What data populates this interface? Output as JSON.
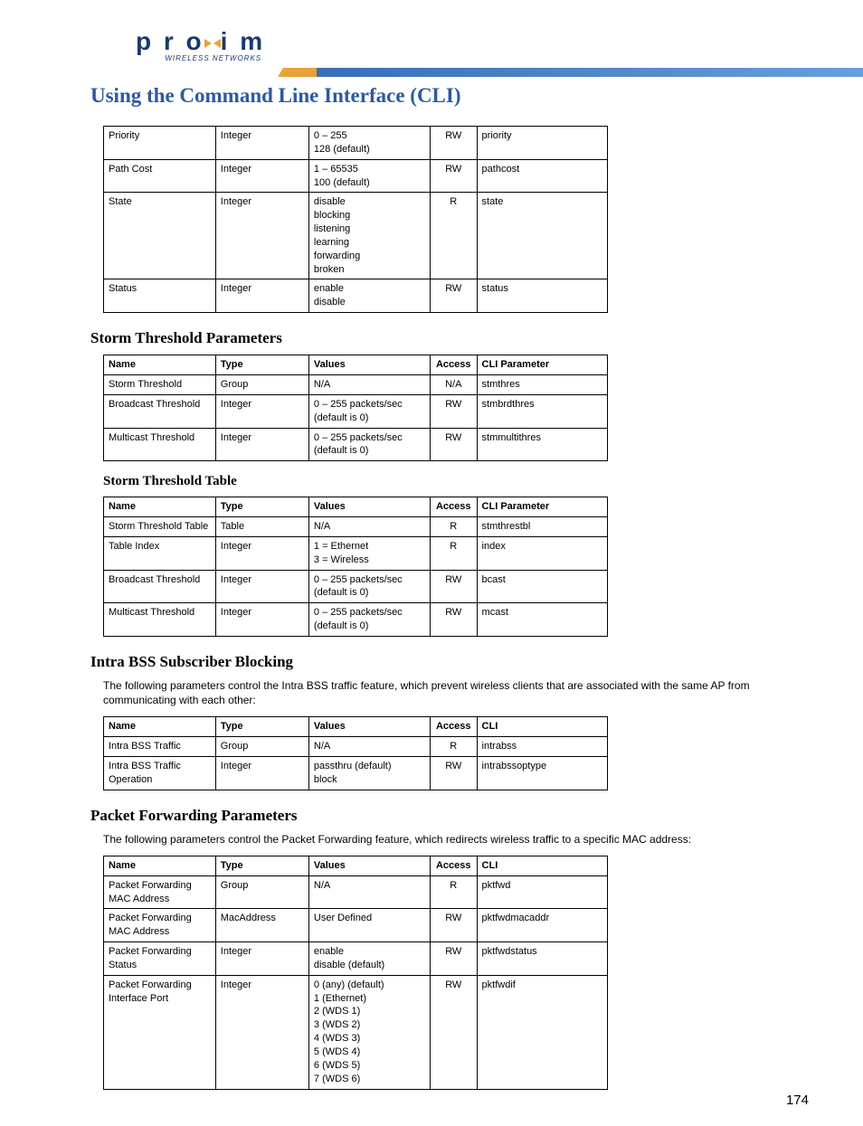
{
  "brand": {
    "name": "proxim",
    "tagline": "WIRELESS NETWORKS"
  },
  "page_title": "Using the Command Line Interface (CLI)",
  "page_number": "174",
  "tables": {
    "top": {
      "rows": [
        {
          "name": "Priority",
          "type": "Integer",
          "values": "0 – 255\n128 (default)",
          "access": "RW",
          "cli": "priority"
        },
        {
          "name": "Path Cost",
          "type": "Integer",
          "values": "1 – 65535\n100 (default)",
          "access": "RW",
          "cli": "pathcost"
        },
        {
          "name": "State",
          "type": "Integer",
          "values": "disable\nblocking\nlistening\nlearning\nforwarding\nbroken",
          "access": "R",
          "cli": "state"
        },
        {
          "name": "Status",
          "type": "Integer",
          "values": "enable\ndisable",
          "access": "RW",
          "cli": "status"
        }
      ]
    },
    "storm_params": {
      "heading": "Storm Threshold Parameters",
      "headers": {
        "name": "Name",
        "type": "Type",
        "values": "Values",
        "access": "Access",
        "cli": "CLI Parameter"
      },
      "rows": [
        {
          "name": "Storm Threshold",
          "type": "Group",
          "values": "N/A",
          "access": "N/A",
          "cli": "stmthres"
        },
        {
          "name": "Broadcast Threshold",
          "type": "Integer",
          "values": "0 – 255 packets/sec\n(default is 0)",
          "access": "RW",
          "cli": "stmbrdthres"
        },
        {
          "name": "Multicast Threshold",
          "type": "Integer",
          "values": "0 – 255 packets/sec\n(default is 0)",
          "access": "RW",
          "cli": "stmmultithres"
        }
      ]
    },
    "storm_table": {
      "heading": "Storm Threshold Table",
      "headers": {
        "name": "Name",
        "type": "Type",
        "values": "Values",
        "access": "Access",
        "cli": "CLI Parameter"
      },
      "rows": [
        {
          "name": "Storm Threshold Table",
          "type": "Table",
          "values": "N/A",
          "access": "R",
          "cli": "stmthrestbl"
        },
        {
          "name": "Table Index",
          "type": "Integer",
          "values": "1 = Ethernet\n3 = Wireless",
          "access": "R",
          "cli": "index"
        },
        {
          "name": "Broadcast Threshold",
          "type": "Integer",
          "values": "0 – 255 packets/sec\n(default is 0)",
          "access": "RW",
          "cli": "bcast"
        },
        {
          "name": "Multicast Threshold",
          "type": "Integer",
          "values": "0 – 255 packets/sec\n(default is 0)",
          "access": "RW",
          "cli": "mcast"
        }
      ]
    },
    "intra_bss": {
      "heading": "Intra BSS Subscriber Blocking",
      "intro": "The following parameters control the Intra BSS traffic feature, which prevent wireless clients that are associated with the same AP from communicating with each other:",
      "headers": {
        "name": "Name",
        "type": "Type",
        "values": "Values",
        "access": "Access",
        "cli": "CLI"
      },
      "rows": [
        {
          "name": "Intra BSS Traffic",
          "type": "Group",
          "values": "N/A",
          "access": "R",
          "cli": "intrabss"
        },
        {
          "name": "Intra BSS Traffic Operation",
          "type": "Integer",
          "values": "passthru (default)\nblock",
          "access": "RW",
          "cli": "intrabssoptype"
        }
      ]
    },
    "packet_fwd": {
      "heading": "Packet Forwarding Parameters",
      "intro": "The following parameters control the Packet Forwarding feature, which redirects wireless traffic to a specific MAC address:",
      "headers": {
        "name": "Name",
        "type": "Type",
        "values": "Values",
        "access": "Access",
        "cli": "CLI"
      },
      "rows": [
        {
          "name": "Packet Forwarding MAC Address",
          "type": "Group",
          "values": "N/A",
          "access": "R",
          "cli": "pktfwd"
        },
        {
          "name": "Packet Forwarding MAC Address",
          "type": "MacAddress",
          "values": "User Defined",
          "access": "RW",
          "cli": "pktfwdmacaddr"
        },
        {
          "name": "Packet Forwarding Status",
          "type": "Integer",
          "values": "enable\ndisable (default)",
          "access": "RW",
          "cli": "pktfwdstatus"
        },
        {
          "name": "Packet Forwarding Interface Port",
          "type": "Integer",
          "values": "0 (any) (default)\n1 (Ethernet)\n2 (WDS 1)\n3 (WDS 2)\n4 (WDS 3)\n5 (WDS 4)\n6 (WDS 5)\n7 (WDS 6)",
          "access": "RW",
          "cli": "pktfwdif"
        }
      ]
    }
  }
}
